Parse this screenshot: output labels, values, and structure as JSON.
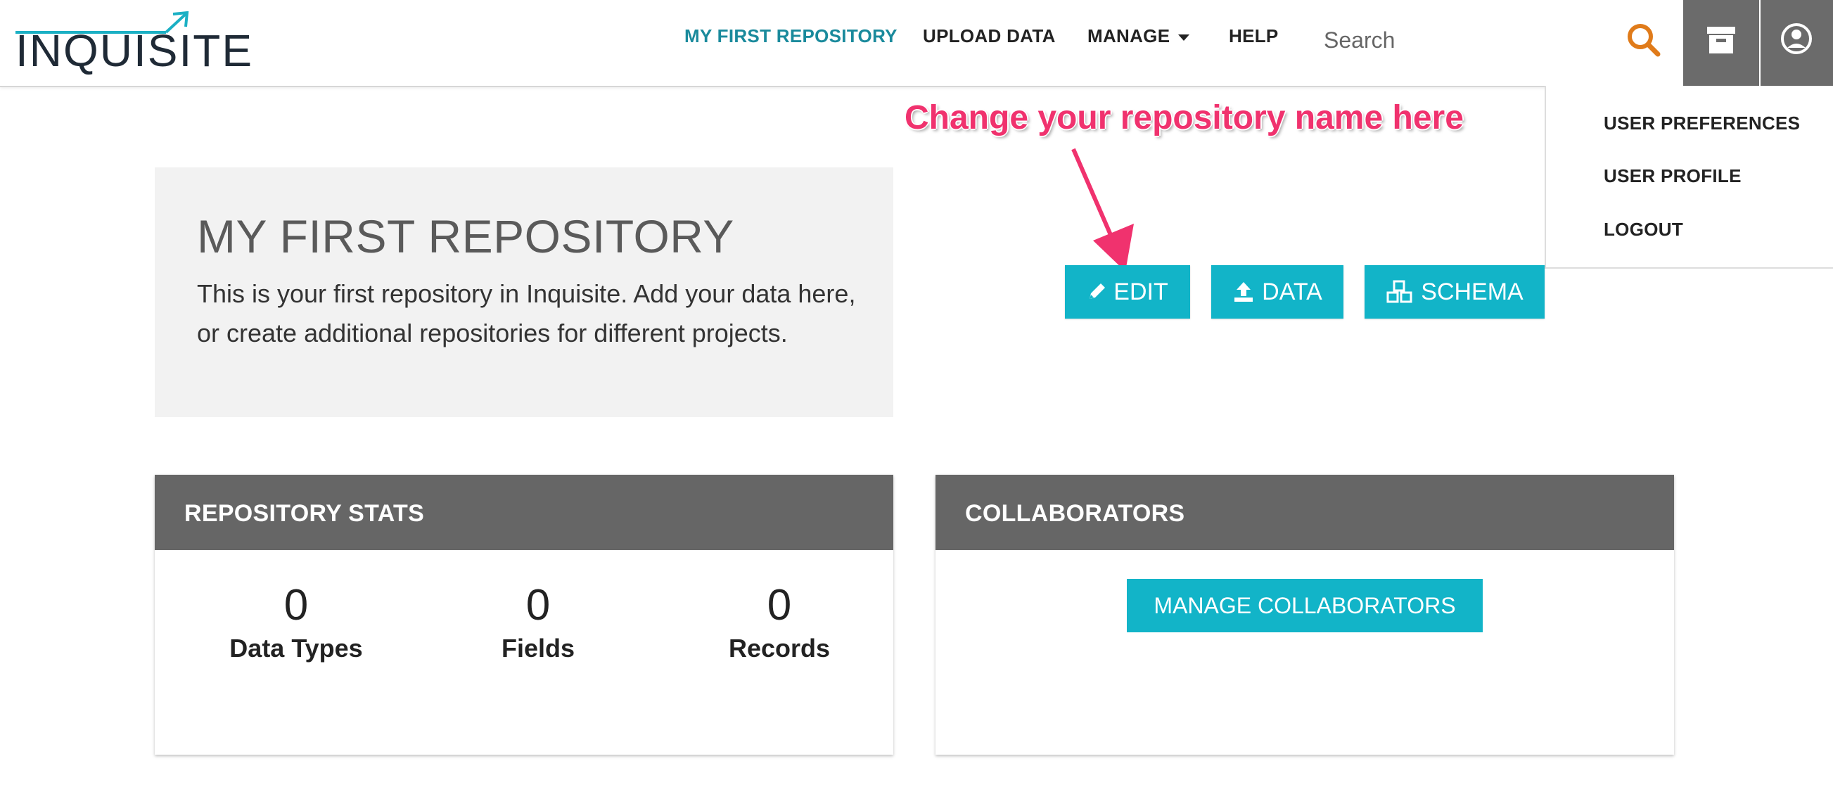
{
  "header": {
    "logo_text": "INQUISITE",
    "nav": [
      {
        "label": "MY FIRST REPOSITORY",
        "active": true
      },
      {
        "label": "UPLOAD DATA"
      },
      {
        "label": "MANAGE"
      },
      {
        "label": "HELP"
      }
    ],
    "search": {
      "placeholder": "Search"
    }
  },
  "user_menu": {
    "items": [
      "USER PREFERENCES",
      "USER PROFILE",
      "LOGOUT"
    ]
  },
  "annotation": {
    "text": "Change your repository name here"
  },
  "repository": {
    "title": "MY FIRST REPOSITORY",
    "description": "This is your first repository in Inquisite. Add your data here, or create additional repositories for different projects."
  },
  "actions": {
    "edit": "EDIT",
    "data": "DATA",
    "schema": "SCHEMA"
  },
  "stats_card": {
    "title": "REPOSITORY STATS",
    "stats": [
      {
        "value": "0",
        "label": "Data Types"
      },
      {
        "value": "0",
        "label": "Fields"
      },
      {
        "value": "0",
        "label": "Records"
      }
    ]
  },
  "collaborators_card": {
    "title": "COLLABORATORS",
    "button": "MANAGE COLLABORATORS"
  },
  "colors": {
    "accent": "#12b4c8",
    "nav_active": "#1a8a9c",
    "search_icon": "#e07b1a",
    "annotation": "#f0326e",
    "card_header": "#666666"
  },
  "icons": [
    "search-icon",
    "archive-icon",
    "user-icon",
    "pencil-icon",
    "upload-icon",
    "cubes-icon"
  ]
}
